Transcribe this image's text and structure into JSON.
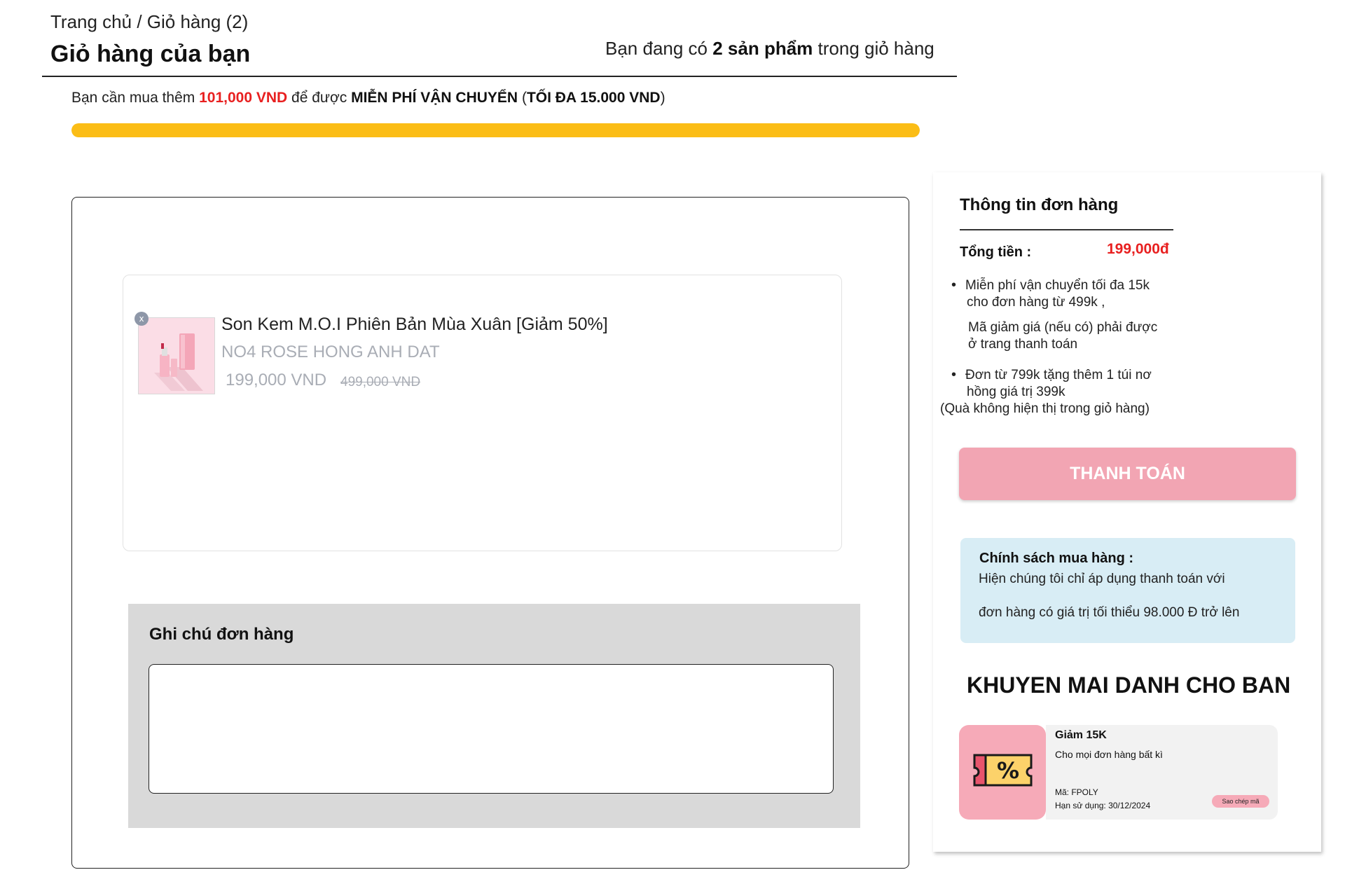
{
  "header": {
    "breadcrumb": "Trang chủ / Giỏ hàng (2)",
    "title": "Giỏ hàng của bạn",
    "cart_count_prefix": "Bạn đang có ",
    "cart_count_bold": "2 sản phẩm",
    "cart_count_suffix": " trong giỏ hàng"
  },
  "free_shipping": {
    "prefix": "Bạn cần mua thêm ",
    "amount": "101,000 VND",
    "middle": " để được ",
    "highlight": "MIỄN PHÍ VẬN CHUYỂN",
    "paren_open": " (",
    "max_note": "TỐI ĐA 15.000 VND",
    "paren_close": ")",
    "progress_percent": 100,
    "progress_color": "#fbbd16"
  },
  "cart": {
    "items": [
      {
        "remove_label": "x",
        "name": "Son Kem M.O.I Phiên Bản Mùa Xuân [Giảm 50%]",
        "variant": "NO4 ROSE HONG ANH DAT",
        "price": "199,000 VND",
        "old_price": "499,000 VND",
        "thumbnail_icon": "lipstick-product-image"
      }
    ],
    "note": {
      "title": "Ghi chú đơn hàng",
      "value": "",
      "placeholder": ""
    }
  },
  "summary": {
    "title": "Thông tin đơn hàng",
    "total_label": "Tổng tiền :",
    "total_value": "199,000đ",
    "info": {
      "b1_line1": "Miễn phí vận chuyển tối đa 15k",
      "b1_line2": "cho đơn hàng từ 499k ,",
      "b1_line3": "Mã giảm giá (nếu có) phải được",
      "b1_line4": "ở trang  thanh toán",
      "b2_line1": "Đơn từ 799k tặng thêm 1 túi nơ",
      "b2_line2": "hồng giá trị 399k",
      "b2_line3": "(Quà không hiện thị trong giỏ hàng)"
    },
    "checkout_label": "THANH TOÁN",
    "policy": {
      "title": "Chính sách mua hàng :",
      "line1": "Hiện chúng tôi chỉ áp dụng thanh toán với",
      "line2": "đơn hàng có giá trị tối thiểu 98.000 Đ trở lên"
    },
    "promo_heading": "KHUYEN MAI DANH CHO BAN",
    "voucher": {
      "title": "Giảm 15K",
      "description": "Cho mọi đơn hàng bất kì",
      "code": "Mã: FPOLY",
      "expiry": "Hạn sử dụng: 30/12/2024",
      "copy_label": "Sao chép mã",
      "icon": "discount-ticket-icon",
      "icon_symbol": "%"
    }
  },
  "colors": {
    "accent_red": "#e82020",
    "progress": "#fbbd16",
    "checkout": "#f2a5b3",
    "policy_bg": "#d8edf5",
    "voucher_pink": "#f6aab8"
  }
}
